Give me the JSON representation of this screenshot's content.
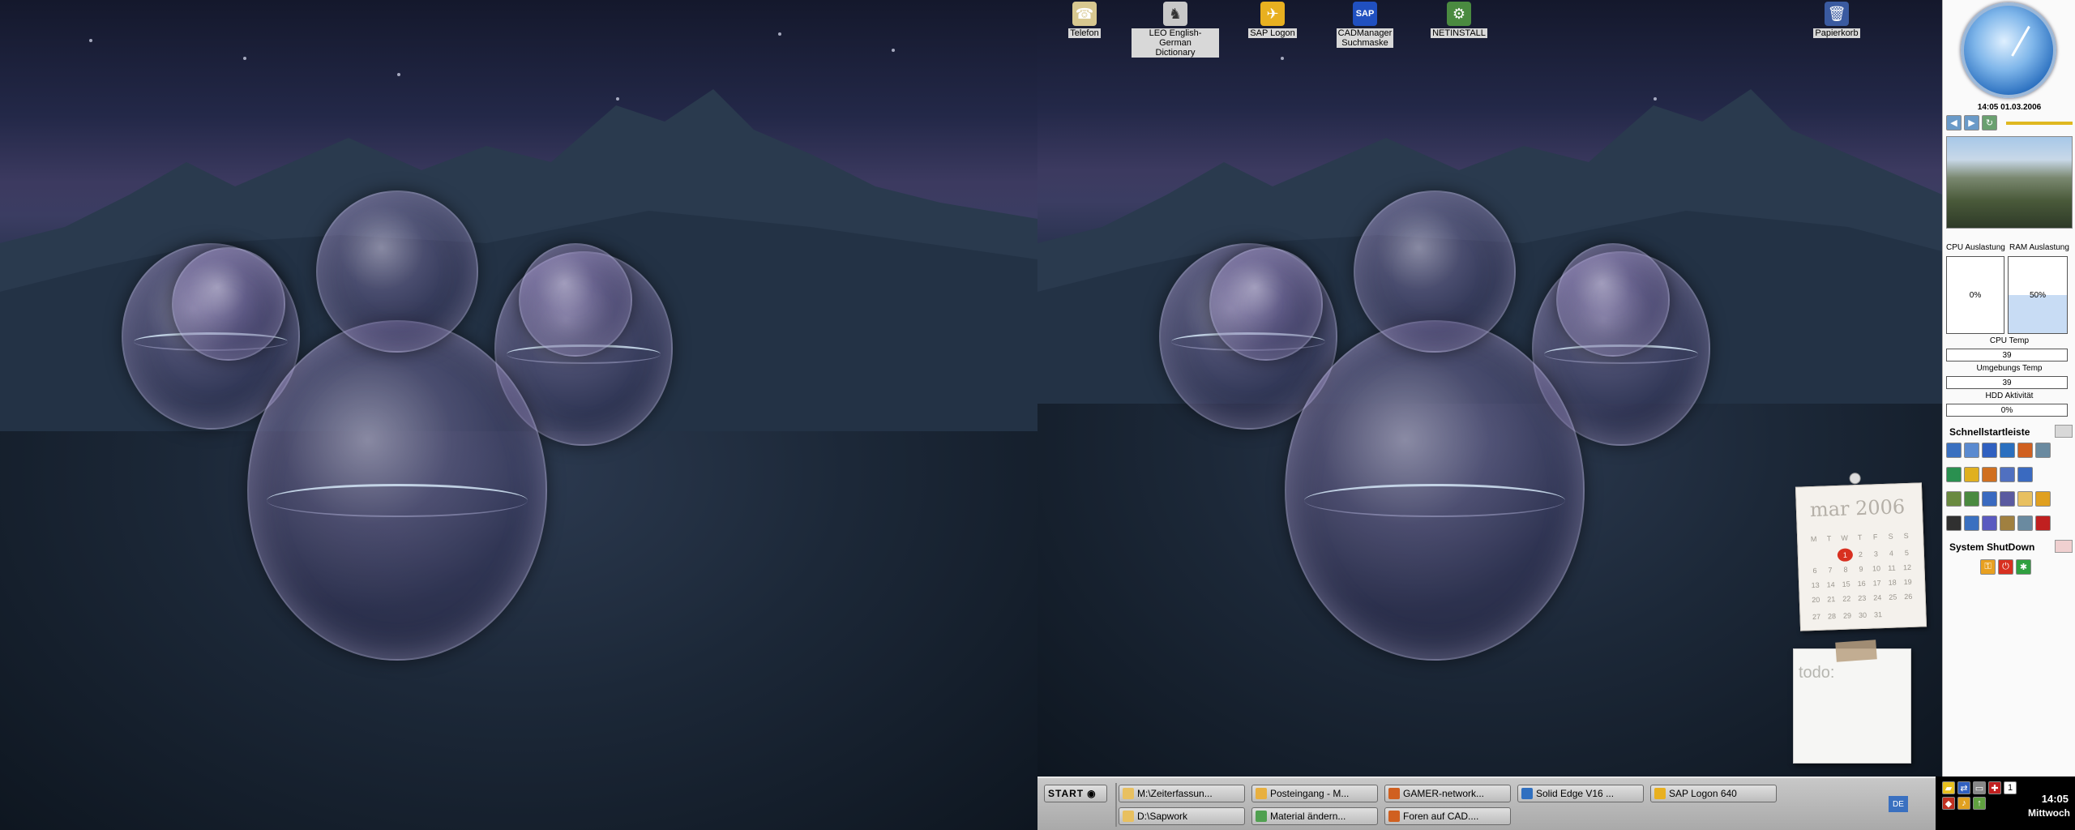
{
  "desktop_icons": [
    {
      "label": "Telefon",
      "icon": "phone-icon",
      "color": "#d8c890"
    },
    {
      "label": "LEO English-German\nDictionary",
      "icon": "leo-lion-icon",
      "color": "#c8c8c8"
    },
    {
      "label": "SAP Logon",
      "icon": "sap-logon-icon",
      "color": "#e8b020"
    },
    {
      "label": "CADManager\nSuchmaske",
      "icon": "sap-icon",
      "color": "#2050c0"
    },
    {
      "label": "NETINSTALL",
      "icon": "install-icon",
      "color": "#4a8a40"
    },
    {
      "label": "Papierkorb",
      "icon": "recycle-bin-icon",
      "color": "#3a5aa0"
    }
  ],
  "sidebar": {
    "datetime": "14:05 01.03.2006",
    "cpu_label": "CPU Auslastung",
    "ram_label": "RAM Auslastung",
    "cpu_value": "0%",
    "ram_value": "50%",
    "cpu_fraction": 0.0,
    "ram_fraction": 0.5,
    "cpu_temp_label": "CPU Temp",
    "cpu_temp_value": "39",
    "env_temp_label": "Umgebungs Temp",
    "env_temp_value": "39",
    "hdd_label": "HDD Aktivität",
    "hdd_value": "0%",
    "quicklaunch_label": "Schnellstartleiste",
    "shutdown_label": "System ShutDown"
  },
  "calendar": {
    "month": "mar 2006",
    "weekdays": [
      "M",
      "T",
      "W",
      "T",
      "F",
      "S",
      "S"
    ],
    "weeks": [
      [
        "",
        "",
        "1",
        "2",
        "3",
        "4",
        "5"
      ],
      [
        "6",
        "7",
        "8",
        "9",
        "10",
        "11",
        "12"
      ],
      [
        "13",
        "14",
        "15",
        "16",
        "17",
        "18",
        "19"
      ],
      [
        "20",
        "21",
        "22",
        "23",
        "24",
        "25",
        "26"
      ],
      [
        "27",
        "28",
        "29",
        "30",
        "31",
        "",
        ""
      ]
    ],
    "today": "1"
  },
  "todo": {
    "title": "todo:"
  },
  "taskbar": {
    "start_label": "START",
    "row1": [
      {
        "label": "M:\\Zeiterfassun...",
        "color": "#e8c060"
      },
      {
        "label": "Posteingang - M...",
        "color": "#e8b040"
      },
      {
        "label": "GAMER-network...",
        "color": "#d06020"
      },
      {
        "label": "Solid Edge V16 ...",
        "color": "#3070c0"
      },
      {
        "label": "SAP Logon 640",
        "color": "#e8b020"
      }
    ],
    "row2": [
      {
        "label": "D:\\Sapwork",
        "color": "#e8c060"
      },
      {
        "label": "Material ändern...",
        "color": "#50a050"
      },
      {
        "label": "Foren auf CAD....",
        "color": "#d06020"
      }
    ],
    "lang": "DE"
  },
  "tray": {
    "time": "14:05",
    "day": "Mittwoch",
    "count": "1"
  },
  "colors": {
    "accent": "#2a6fbf",
    "panel_bg": "#fafafa",
    "taskbar": "#b8b8b8"
  }
}
